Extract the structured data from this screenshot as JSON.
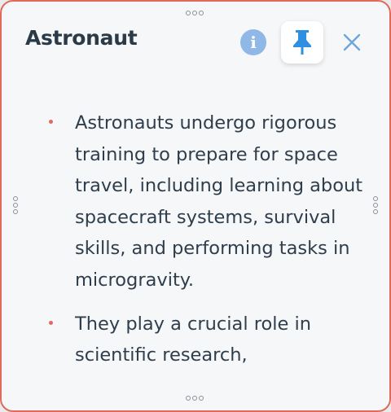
{
  "card": {
    "title": "Astronaut",
    "buttons": {
      "info_icon": "info-icon",
      "pin_icon": "pin-icon",
      "close_icon": "close-icon"
    },
    "bullets": [
      "Astronauts undergo rigorous training to prepare for space travel, including learning about spacecraft systems, survival skills, and performing tasks in microgravity.",
      "They play a crucial role in scientific research,"
    ]
  },
  "colors": {
    "border": "#e06a5c",
    "info_bg": "#8fb8e6",
    "pin": "#2f8fe0",
    "close": "#6fa4dc",
    "bullet_dot": "#e26a5a",
    "text": "#2f3e4c"
  }
}
